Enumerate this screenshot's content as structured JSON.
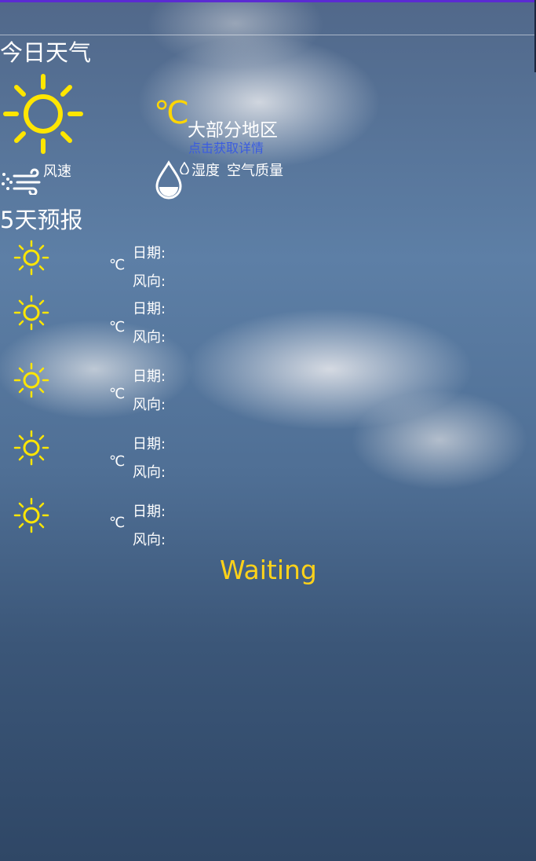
{
  "today": {
    "title": "今日天气",
    "weather_icon": "sun-icon",
    "wind_label": "风速",
    "temp_unit": "℃",
    "region": "大部分地区",
    "detail_link": "点击获取详情",
    "humidity_label": "湿度",
    "air_quality_label": "空气质量"
  },
  "forecast": {
    "title": "5天预报",
    "days": [
      {
        "icon": "sun-icon",
        "unit": "℃",
        "date_label": "日期:",
        "wind_label": "风向:"
      },
      {
        "icon": "sun-icon",
        "unit": "℃",
        "date_label": "日期:",
        "wind_label": "风向:"
      },
      {
        "icon": "sun-icon",
        "unit": "℃",
        "date_label": "日期:",
        "wind_label": "风向:"
      },
      {
        "icon": "sun-icon",
        "unit": "℃",
        "date_label": "日期:",
        "wind_label": "风向:"
      },
      {
        "icon": "sun-icon",
        "unit": "℃",
        "date_label": "日期:",
        "wind_label": "风向:"
      }
    ]
  },
  "status": {
    "text": "Waiting"
  },
  "colors": {
    "accent_yellow": "#ffd600",
    "link_blue": "#3a5ce0",
    "status_bar": "#5b2bd3",
    "status_text": "#ffd21a"
  }
}
